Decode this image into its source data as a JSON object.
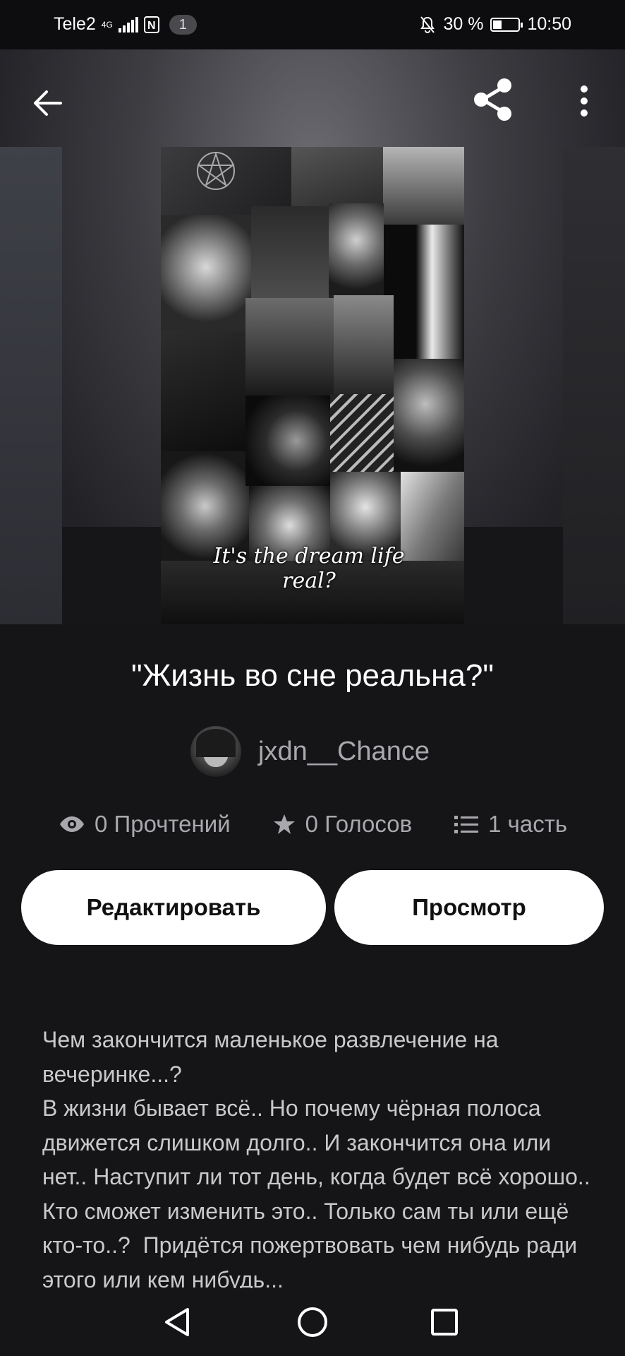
{
  "status_bar": {
    "carrier": "Tele2",
    "network": "4G",
    "notification_count": "1",
    "battery_percent": "30 %",
    "time": "10:50"
  },
  "book": {
    "cover_caption": "It's the dream life real?",
    "title": "\"Жизнь во сне реальна?\"",
    "author": "jxdn__Chance",
    "stats": {
      "reads": "0 Прочтений",
      "votes": "0 Голосов",
      "parts": "1 часть"
    },
    "description": "Чем закончится маленькое развлечение на вечеринке...?\nВ жизни бывает всё.. Но почему чёрная полоса движется слишком долго.. И закончится она или нет.. Наступит ли тот день, когда будет всё хорошо.. Кто сможет изменить это.. Только сам ты или ещё кто-то..?  Придётся пожертвовать чем нибудь ради этого или кем нибудь..."
  },
  "buttons": {
    "edit": "Редактировать",
    "preview": "Просмотр"
  },
  "icons": {
    "back": "arrow-left-icon",
    "share": "share-icon",
    "more": "more-vertical-icon",
    "reads": "eye-icon",
    "votes": "star-icon",
    "parts": "list-icon"
  }
}
